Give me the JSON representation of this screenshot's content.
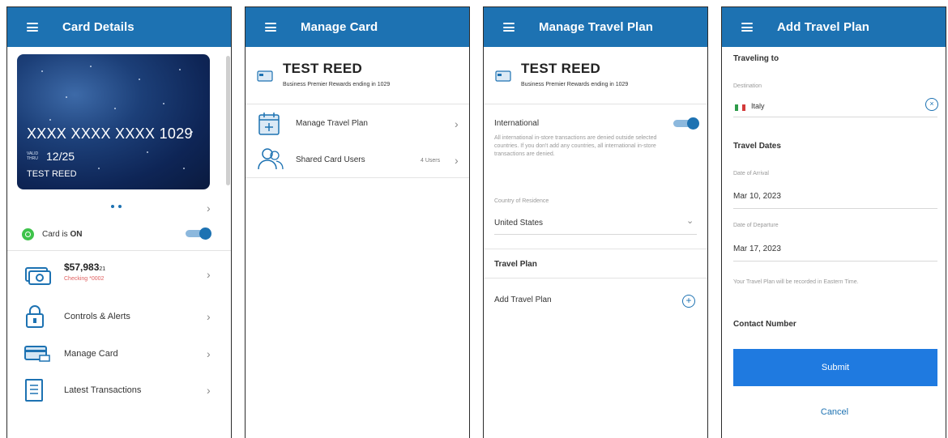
{
  "colors": {
    "primary": "#1d72b2",
    "submit": "#1f7ae0",
    "status_on": "#3ec34a",
    "warning_text": "#e06060"
  },
  "screen1": {
    "title": "Card Details",
    "card": {
      "number": "XXXX XXXX XXXX 1029",
      "expiry_label": "VALID THRU",
      "expiry": "12/25",
      "name": "TEST REED"
    },
    "card_status": {
      "prefix": "Card is ",
      "state": "ON",
      "toggle_on": true
    },
    "balance": {
      "amount": "$57,983",
      "cents": "21",
      "account": "Checking *0002"
    },
    "menu": [
      {
        "label": "Controls & Alerts",
        "icon": "lock-icon"
      },
      {
        "label": "Manage Card",
        "icon": "card-icon"
      },
      {
        "label": "Latest Transactions",
        "icon": "receipt-icon"
      }
    ]
  },
  "screen2": {
    "title": "Manage Card",
    "holder_name": "TEST REED",
    "holder_sub": "Business Premier Rewards ending in 1029",
    "items": [
      {
        "label": "Manage Travel Plan",
        "icon": "calendar-icon"
      },
      {
        "label": "Shared Card Users",
        "icon": "users-icon",
        "count": "4 Users"
      }
    ]
  },
  "screen3": {
    "title": "Manage Travel Plan",
    "holder_name": "TEST REED",
    "holder_sub": "Business Premier Rewards ending in 1029",
    "international": {
      "label": "International",
      "toggle_on": true,
      "description": "All international in-store transactions are denied outside selected countries. If you don't add any countries, all international in-store transactions are denied."
    },
    "residence": {
      "label": "Country of Residence",
      "value": "United States"
    },
    "travel_plan_heading": "Travel Plan",
    "add_travel_plan": "Add Travel Plan"
  },
  "screen4": {
    "title": "Add Travel Plan",
    "traveling_to": "Traveling to",
    "destination": {
      "label": "Destination",
      "value": "Italy"
    },
    "travel_dates": "Travel Dates",
    "arrival": {
      "label": "Date of Arrival",
      "value": "Mar 10, 2023"
    },
    "departure": {
      "label": "Date of Departure",
      "value": "Mar 17, 2023"
    },
    "note": "Your Travel Plan will be recorded in Eastern Time.",
    "contact_number": "Contact Number",
    "submit_label": "Submit",
    "cancel_label": "Cancel"
  }
}
